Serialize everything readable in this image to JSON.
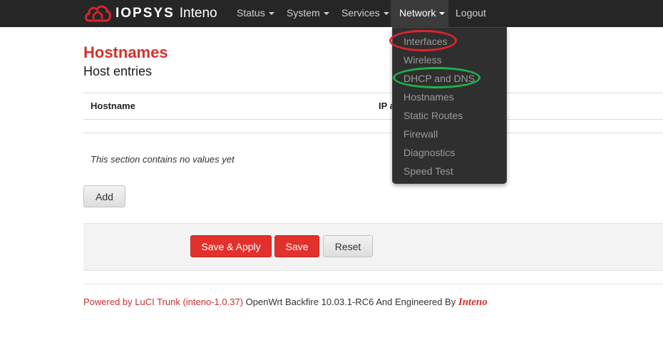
{
  "navbar": {
    "brand_text": "IOPSYS",
    "brand_name": "Inteno",
    "menu": [
      {
        "label": "Status"
      },
      {
        "label": "System"
      },
      {
        "label": "Services"
      },
      {
        "label": "Network"
      },
      {
        "label": "Logout"
      }
    ]
  },
  "dropdown": {
    "items": [
      {
        "label": "Interfaces"
      },
      {
        "label": "Wireless"
      },
      {
        "label": "DHCP and DNS"
      },
      {
        "label": "Hostnames"
      },
      {
        "label": "Static Routes"
      },
      {
        "label": "Firewall"
      },
      {
        "label": "Diagnostics"
      },
      {
        "label": "Speed Test"
      }
    ]
  },
  "highlights": {
    "interfaces_color": "#e0232d",
    "dhcp_color": "#1db34a"
  },
  "page": {
    "title": "Hostnames",
    "subtitle": "Host entries",
    "columns": [
      "Hostname",
      "IP a"
    ],
    "empty_message": "This section contains no values yet",
    "add_label": "Add"
  },
  "actions": {
    "save_apply_label": "Save & Apply",
    "save_label": "Save",
    "reset_label": "Reset"
  },
  "footer": {
    "powered": "Powered by LuCI Trunk (inteno-1.0.37)",
    "rest": "OpenWrt Backfire 10.03.1-RC6 And Engineered By",
    "logo": "Inteno"
  },
  "colors": {
    "accent": "#d2322d",
    "navbar": "#262626",
    "dropdown": "#2f2f2f"
  }
}
